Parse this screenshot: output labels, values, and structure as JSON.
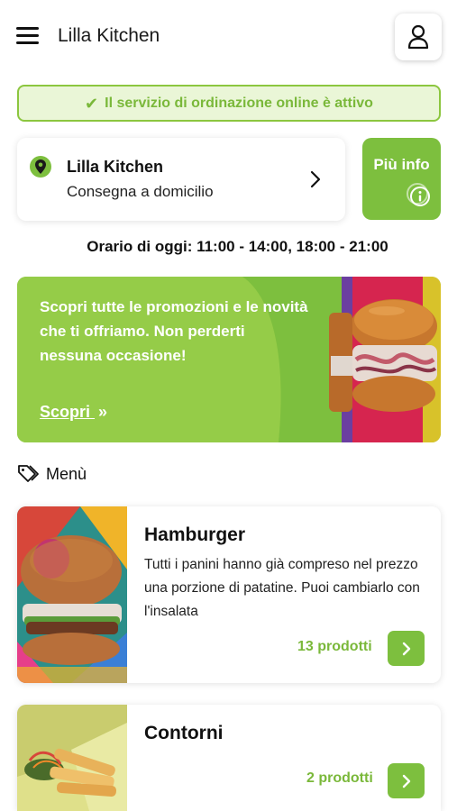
{
  "header": {
    "menu_icon": "hamburger-menu-icon",
    "title": "Lilla Kitchen",
    "user_icon": "user-icon"
  },
  "status": {
    "icon": "check-icon",
    "text": "Il servizio di ordinazione online è attivo",
    "color": "#8cc63f"
  },
  "store": {
    "name": "Lilla Kitchen",
    "mode": "Consegna a domicilio",
    "icon": "location-pin-icon"
  },
  "info_button": {
    "label": "Più info",
    "icon": "info-icon"
  },
  "hours": "Orario di oggi: 11:00 - 14:00, 18:00 - 21:00",
  "promo": {
    "text": "Scopri tutte le promozioni e le novità che ti offriamo. Non perderti nessuna occasione!",
    "link": "Scopri"
  },
  "menu_section": {
    "icon": "tag-icon",
    "label": "Menù"
  },
  "categories": [
    {
      "title": "Hamburger",
      "description": "Tutti i panini hanno già compreso nel prezzo una porzione di patatine. Puoi cambiarlo con l'insalata",
      "count": "13 prodotti"
    },
    {
      "title": "Contorni",
      "description": "",
      "count": "2 prodotti"
    }
  ],
  "colors": {
    "accent": "#7dbf3e",
    "accent_light": "#eaf6d7"
  }
}
